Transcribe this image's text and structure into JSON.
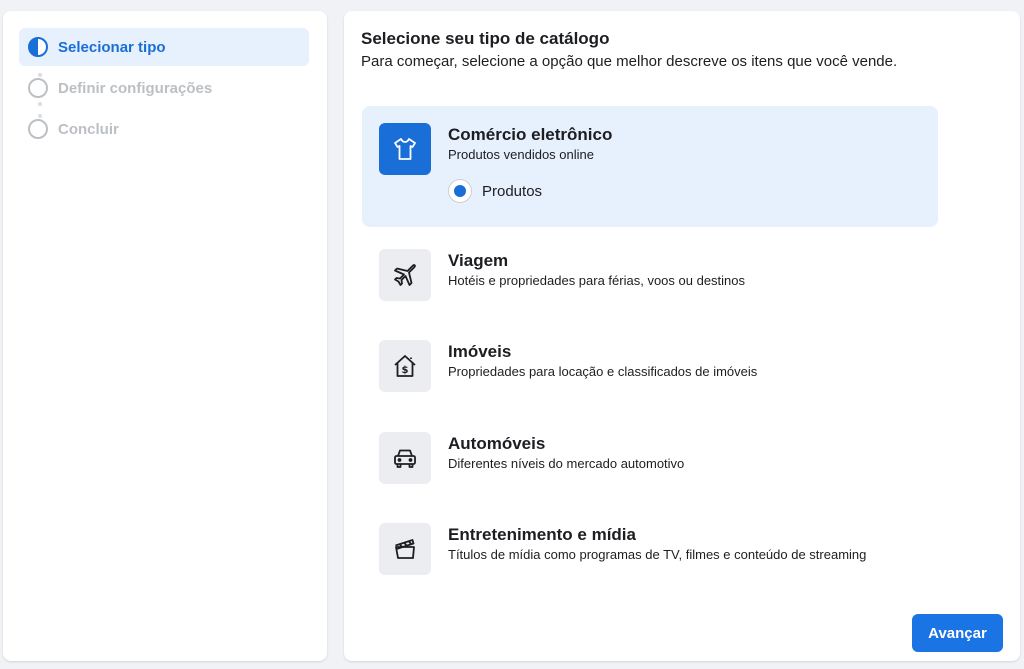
{
  "colors": {
    "accent": "#1a6ed8",
    "selected_bg": "#e7f0fd",
    "button": "#1b74e4",
    "inactive_step": "#bcc0c4"
  },
  "steps": [
    {
      "label": "Selecionar tipo",
      "state": "active"
    },
    {
      "label": "Definir configurações",
      "state": "pending"
    },
    {
      "label": "Concluir",
      "state": "pending"
    }
  ],
  "main": {
    "title": "Selecione seu tipo de catálogo",
    "subtitle": "Para começar, selecione a opção que melhor descreve os itens que você vende.",
    "options": [
      {
        "title": "Comércio eletrônico",
        "description": "Produtos vendidos online",
        "icon": "tshirt-icon",
        "selected": true,
        "radio_label": "Produtos"
      },
      {
        "title": "Viagem",
        "description": "Hotéis e propriedades para férias, voos ou destinos",
        "icon": "airplane-icon",
        "selected": false
      },
      {
        "title": "Imóveis",
        "description": "Propriedades para locação e classificados de imóveis",
        "icon": "house-dollar-icon",
        "selected": false
      },
      {
        "title": "Automóveis",
        "description": "Diferentes níveis do mercado automotivo",
        "icon": "car-icon",
        "selected": false
      },
      {
        "title": "Entretenimento e mídia",
        "description": "Títulos de mídia como programas de TV, filmes e conteúdo de streaming",
        "icon": "clapperboard-icon",
        "selected": false
      }
    ],
    "next_label": "Avançar"
  }
}
